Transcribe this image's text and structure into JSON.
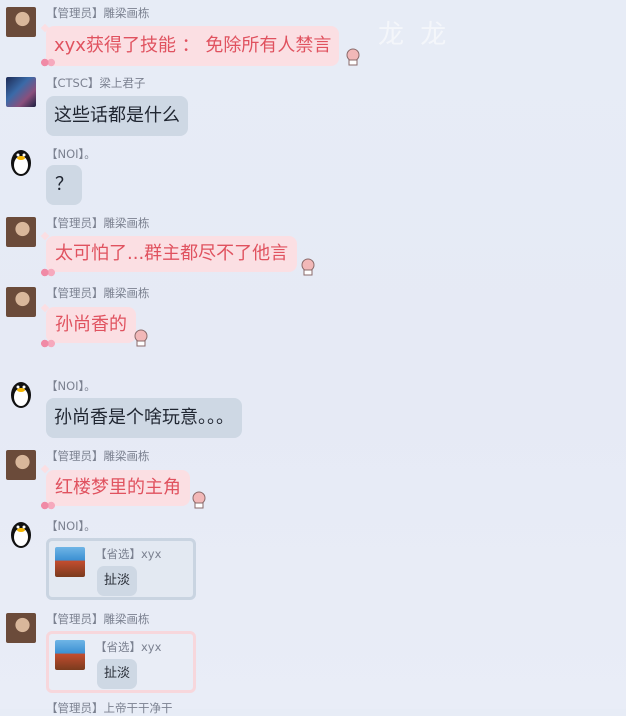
{
  "watermark": "龙 龙",
  "messages": [
    {
      "sender": "【管理员】雕梁画栋",
      "text": "xyx获得了技能 ： 免除所有人禁言"
    },
    {
      "sender": "【CTSC】梁上君子",
      "text": "这些话都是什么"
    },
    {
      "sender": "【NOI】。",
      "text": "？"
    },
    {
      "sender": "【管理员】雕梁画栋",
      "text": "太可怕了...群主都尽不了他言"
    },
    {
      "sender": "【管理员】雕梁画栋",
      "text": "孙尚香的"
    },
    {
      "sender": "【NOI】。",
      "text": "孙尚香是个啥玩意。。。"
    },
    {
      "sender": "【管理员】雕梁画栋",
      "text": "红楼梦里的主角"
    },
    {
      "sender": "【NOI】。",
      "quote": {
        "sender": "【省选】xyx",
        "text": "扯淡"
      }
    },
    {
      "sender": "【管理员】雕梁画栋",
      "quote": {
        "sender": "【省选】xyx",
        "text": "扯淡"
      }
    },
    {
      "sender": "【管理员】上帝干干净干"
    }
  ],
  "colors": {
    "admin_bubble": "#fbdfe3",
    "admin_text": "#e0525f",
    "member_bubble": "#ced8e4"
  }
}
